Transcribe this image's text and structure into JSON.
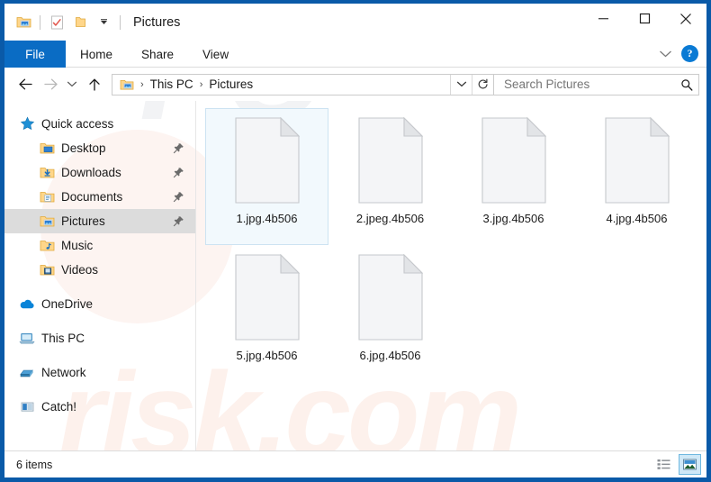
{
  "window": {
    "title": "Pictures",
    "quick_access_toolbar": [
      {
        "name": "properties-icon",
        "label": "Properties"
      },
      {
        "name": "new-folder-icon",
        "label": "New folder"
      },
      {
        "name": "customize-quick-access-chevron-icon",
        "label": "Customize Quick Access Toolbar"
      }
    ],
    "controls": [
      {
        "name": "minimize-button",
        "glyph": "—",
        "label": "Minimize"
      },
      {
        "name": "maximize-button",
        "glyph": "☐",
        "label": "Maximize"
      },
      {
        "name": "close-button",
        "glyph": "✕",
        "label": "Close"
      }
    ]
  },
  "ribbon": {
    "tabs": [
      {
        "label": "File",
        "active": true
      },
      {
        "label": "Home",
        "active": false
      },
      {
        "label": "Share",
        "active": false
      },
      {
        "label": "View",
        "active": false
      }
    ],
    "expand_label": "Expand the Ribbon",
    "help_label": "?"
  },
  "address": {
    "back_label": "Back",
    "forward_label": "Forward",
    "recent_label": "Recent locations",
    "up_label": "Up",
    "breadcrumbs": [
      "This PC",
      "Pictures"
    ],
    "separator": "›",
    "dropdown_label": "Previous locations",
    "refresh_label": "Refresh"
  },
  "search": {
    "placeholder": "Search Pictures",
    "value": ""
  },
  "sidebar": {
    "items": [
      {
        "label": "Quick access",
        "icon": "star-icon",
        "level": 0,
        "pinned": false,
        "selected": false
      },
      {
        "label": "Desktop",
        "icon": "desktop-folder-icon",
        "level": 1,
        "pinned": true,
        "selected": false
      },
      {
        "label": "Downloads",
        "icon": "downloads-folder-icon",
        "level": 1,
        "pinned": true,
        "selected": false
      },
      {
        "label": "Documents",
        "icon": "documents-folder-icon",
        "level": 1,
        "pinned": true,
        "selected": false
      },
      {
        "label": "Pictures",
        "icon": "pictures-folder-icon",
        "level": 1,
        "pinned": true,
        "selected": true
      },
      {
        "label": "Music",
        "icon": "music-folder-icon",
        "level": 1,
        "pinned": false,
        "selected": false
      },
      {
        "label": "Videos",
        "icon": "videos-folder-icon",
        "level": 1,
        "pinned": false,
        "selected": false
      },
      {
        "label": "OneDrive",
        "icon": "cloud-icon",
        "level": 0,
        "pinned": false,
        "selected": false
      },
      {
        "label": "This PC",
        "icon": "computer-icon",
        "level": 0,
        "pinned": false,
        "selected": false
      },
      {
        "label": "Network",
        "icon": "network-icon",
        "level": 0,
        "pinned": false,
        "selected": false
      },
      {
        "label": "Catch!",
        "icon": "media-device-icon",
        "level": 0,
        "pinned": false,
        "selected": false
      }
    ]
  },
  "files": [
    {
      "name": "1.jpg.4b506",
      "icon": "blank-file-icon",
      "selected": true
    },
    {
      "name": "2.jpeg.4b506",
      "icon": "blank-file-icon",
      "selected": false
    },
    {
      "name": "3.jpg.4b506",
      "icon": "blank-file-icon",
      "selected": false
    },
    {
      "name": "4.jpg.4b506",
      "icon": "blank-file-icon",
      "selected": false
    },
    {
      "name": "5.jpg.4b506",
      "icon": "blank-file-icon",
      "selected": false
    },
    {
      "name": "6.jpg.4b506",
      "icon": "blank-file-icon",
      "selected": false
    }
  ],
  "statusbar": {
    "item_count": "6 items",
    "views": [
      {
        "name": "details-view-button",
        "label": "Details view",
        "active": false
      },
      {
        "name": "large-icons-view-button",
        "label": "Large icons view",
        "active": true
      }
    ]
  },
  "watermark": {
    "top": "PC",
    "bottom": "risk.com"
  },
  "colors": {
    "window_frame": "#0a5aa8",
    "file_tab": "#0a6cc4",
    "selection": "#f2f9fd",
    "sidebar_selection": "#dcdcdc",
    "help_button": "#0a7ad4"
  }
}
